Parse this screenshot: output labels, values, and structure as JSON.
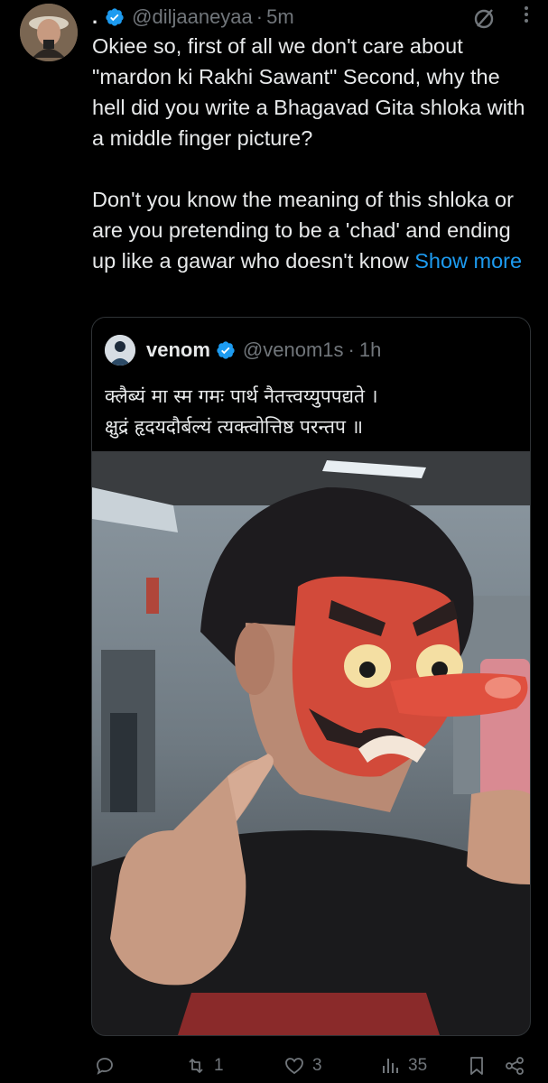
{
  "tweet": {
    "display_name": ".",
    "handle": "@diljaaneyaa",
    "separator": "·",
    "time": "5m",
    "more_icon": "more-icon",
    "text": "Okiee so, first of all we don't care about \"mardon ki Rakhi Sawant\" Second, why the hell did you write a Bhagavad Gita shloka with a middle finger picture?\n\nDon't you know the meaning of this shloka or are you pretending to be a 'chad' and ending up like a gawar who doesn't know ",
    "show_more": "Show more"
  },
  "quote": {
    "display_name": "venom",
    "handle": "@venom1s",
    "separator": "·",
    "time": "1h",
    "text": "क्लैब्यं मा स्म गमः पार्थ नैतत्त्वय्युपपद्यते ।\nक्षुद्रं हृदयदौर्बल्यं त्यक्त्वोत्तिष्ठ परन्तप ॥"
  },
  "actions": {
    "reply_count": "",
    "retweet_count": "1",
    "like_count": "3",
    "views_count": "35"
  },
  "colors": {
    "background": "#000000",
    "text": "#e7e9ea",
    "muted": "#71767b",
    "accent": "#1d9bf0",
    "border": "#2f3336"
  }
}
